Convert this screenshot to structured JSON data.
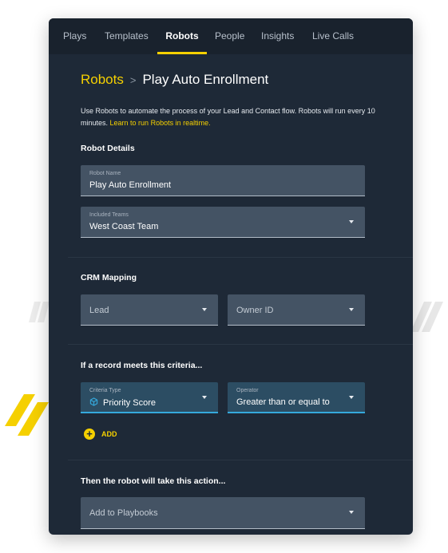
{
  "nav": {
    "tabs": [
      {
        "label": "Plays"
      },
      {
        "label": "Templates"
      },
      {
        "label": "Robots"
      },
      {
        "label": "People"
      },
      {
        "label": "Insights"
      },
      {
        "label": "Live Calls"
      }
    ],
    "active_tab": "Robots",
    "accent": "#f5d000"
  },
  "breadcrumb": {
    "parent": "Robots",
    "separator": ">",
    "current": "Play Auto Enrollment"
  },
  "intro": {
    "text": "Use Robots to automate the process of your Lead and Contact flow. Robots will run every 10 minutes.",
    "link": "Learn to run Robots in realtime."
  },
  "robot_details": {
    "title": "Robot Details",
    "robot_name": {
      "label": "Robot Name",
      "value": "Play Auto Enrollment"
    },
    "included_teams": {
      "label": "Included Teams",
      "value": "West Coast Team",
      "icon": "chevron-down-icon"
    }
  },
  "crm_mapping": {
    "title": "CRM Mapping",
    "lead": {
      "placeholder": "Lead"
    },
    "owner_id": {
      "placeholder": "Owner ID"
    }
  },
  "criteria": {
    "title": "If a record meets this criteria...",
    "criteria_type": {
      "label": "Criteria Type",
      "value": "Priority Score",
      "icon": "cube-icon"
    },
    "operator": {
      "label": "Operator",
      "value": "Greater than or equal to"
    },
    "add_label": "ADD"
  },
  "action": {
    "title": "Then the robot will take this action...",
    "select": {
      "placeholder": "Add to Playbooks"
    }
  },
  "colors": {
    "panel_bg": "#1e2937",
    "field_bg": "#445364",
    "focus_bg": "#2c4d63",
    "focus_border": "#35a9dc"
  }
}
